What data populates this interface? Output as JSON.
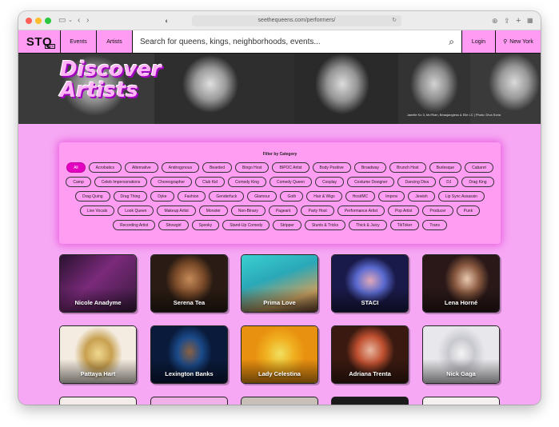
{
  "browser": {
    "url": "seethequeens.com/performers/"
  },
  "nav": {
    "logo": "STQ",
    "badge": "BETA",
    "events": "Events",
    "artists": "Artists",
    "search_placeholder": "Search for queens, kings, neighborhoods, events...",
    "login": "Login",
    "location": "New York"
  },
  "hero": {
    "title_line1": "Discover",
    "title_line2": "Artists",
    "caption": "Janelle Ko 3, Mo'Riah, Beaujangless & Elle LC | Photo: Diva Soria"
  },
  "filter": {
    "heading": "Filter by Category",
    "categories": [
      "All",
      "Acrobatics",
      "Alternative",
      "Androgynous",
      "Bearded",
      "Bingo Host",
      "BIPOC Artist",
      "Body Positive",
      "Broadway",
      "Brunch Host",
      "Burlesque",
      "Cabaret",
      "Camp",
      "Celeb Impersonations",
      "Choreographer",
      "Club Kid",
      "Comedy King",
      "Comedy Queen",
      "Cosplay",
      "Costume Designer",
      "Dancing Diva",
      "DJ",
      "Drag King",
      "Drag Quing",
      "Drag Thing",
      "Dyke",
      "Fashion",
      "Genderfuck",
      "Glamour",
      "Goth",
      "Hair & Wigs",
      "Host/MC",
      "Improv",
      "Jewish",
      "Lip Sync Assassin",
      "Live Vocals",
      "Look Queen",
      "Makeup Artist",
      "Monster",
      "Non-Binary",
      "Pageant",
      "Party Host",
      "Performance Artist",
      "Pop Artist",
      "Producer",
      "Punk",
      "Recording Artist",
      "Showgirl",
      "Spooky",
      "Stand-Up Comedy",
      "Stripper",
      "Stunts & Tricks",
      "Thick & Juicy",
      "TikToker",
      "Trans"
    ],
    "active": "All"
  },
  "artists": [
    {
      "name": "Nicole Anadyme"
    },
    {
      "name": "Serena Tea"
    },
    {
      "name": "Prima Love"
    },
    {
      "name": "STACI"
    },
    {
      "name": "Lena Horné"
    },
    {
      "name": "Pattaya Hart"
    },
    {
      "name": "Lexington Banks"
    },
    {
      "name": "Lady Celestina"
    },
    {
      "name": "Adriana Trenta"
    },
    {
      "name": "Nick Gaga"
    }
  ],
  "colors": {
    "page_bg": "#f6a8f4",
    "nav_bg": "#ff9bf3",
    "active_chip": "#e400c0",
    "title_pink": "#ffb6f6"
  }
}
